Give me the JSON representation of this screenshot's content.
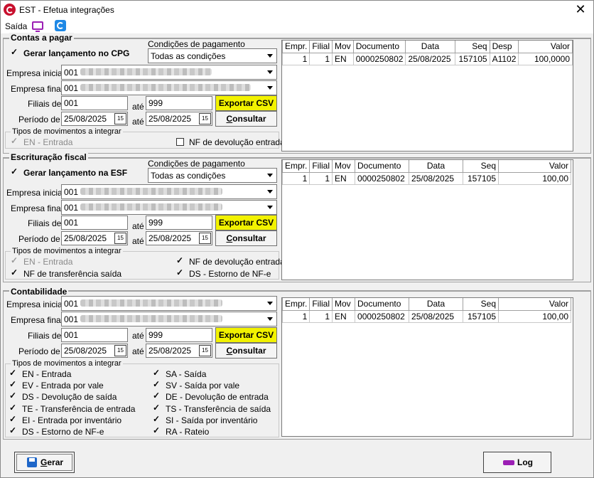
{
  "window": {
    "title": "EST - Efetua integrações",
    "close": "✕"
  },
  "menu": {
    "saida": "Saída"
  },
  "cpg": {
    "title": "Contas a pagar",
    "gerar_label": "Gerar lançamento no CPG",
    "cond_label": "Condições de pagamento",
    "cond_value": "Todas as condições",
    "empresa_inicial_label": "Empresa inicial",
    "empresa_inicial_value": "001",
    "empresa_final_label": "Empresa final",
    "empresa_final_value": "001",
    "filiais_label": "Filiais de",
    "filial_de": "001",
    "ate": "até",
    "filial_ate": "999",
    "exportar": "Exportar CSV",
    "periodo_label": "Período de",
    "periodo_de": "25/08/2025",
    "periodo_ate": "25/08/2025",
    "consultar_c": "C",
    "consultar_rest": "onsultar",
    "tipos_title": "Tipos de movimentos a integrar",
    "tipos": {
      "en": "EN - Entrada",
      "nf_dev": "NF de devolução entrada"
    },
    "grid": {
      "headers": [
        "Empr.",
        "Filial",
        "Mov",
        "Documento",
        "Data",
        "Seq",
        "Desp",
        "Valor"
      ],
      "row": [
        "1",
        "1",
        "EN",
        "0000250802",
        "25/08/2025",
        "157105",
        "A1102",
        "100,0000"
      ]
    }
  },
  "esf": {
    "title": "Escrituração fiscal",
    "gerar_label": "Gerar lançamento na ESF",
    "cond_label": "Condições de pagamento",
    "cond_value": "Todas as condições",
    "empresa_inicial_label": "Empresa inicial",
    "empresa_inicial_value": "001",
    "empresa_final_label": "Empresa final",
    "empresa_final_value": "001",
    "filiais_label": "Filiais de",
    "filial_de": "001",
    "ate": "até",
    "filial_ate": "999",
    "exportar": "Exportar CSV",
    "periodo_label": "Período de",
    "periodo_de": "25/08/2025",
    "periodo_ate": "25/08/2025",
    "consultar_c": "C",
    "consultar_rest": "onsultar",
    "tipos_title": "Tipos de movimentos a integrar",
    "tipos": {
      "en": "EN - Entrada",
      "nf_dev": "NF de devolução entrada",
      "nf_transf": "NF de transferência saída",
      "ds": "DS - Estorno de NF-e"
    },
    "grid": {
      "headers": [
        "Empr.",
        "Filial",
        "Mov",
        "Documento",
        "Data",
        "Seq",
        "Valor"
      ],
      "row": [
        "1",
        "1",
        "EN",
        "0000250802",
        "25/08/2025",
        "157105",
        "100,00"
      ]
    }
  },
  "ctb": {
    "title": "Contabilidade",
    "empresa_inicial_label": "Empresa inicial",
    "empresa_inicial_value": "001",
    "empresa_final_label": "Empresa final",
    "empresa_final_value": "001",
    "filiais_label": "Filiais de",
    "filial_de": "001",
    "ate": "até",
    "filial_ate": "999",
    "exportar": "Exportar CSV",
    "periodo_label": "Período de",
    "periodo_de": "25/08/2025",
    "periodo_ate": "25/08/2025",
    "consultar_c": "C",
    "consultar_rest": "onsultar",
    "tipos_title": "Tipos de movimentos a integrar",
    "tipos_left": [
      "EN - Entrada",
      "EV - Entrada por vale",
      "DS - Devolução de saída",
      "TE - Transferência de entrada",
      "EI - Entrada por inventário",
      "DS - Estorno de NF-e"
    ],
    "tipos_right": [
      "SA - Saída",
      "SV - Saída por vale",
      "DE - Devolução de entrada",
      "TS - Transferência de saída",
      "SI - Saída por inventário",
      "RA - Rateio"
    ],
    "grid": {
      "headers": [
        "Empr.",
        "Filial",
        "Mov",
        "Documento",
        "Data",
        "Seq",
        "Valor"
      ],
      "row": [
        "1",
        "1",
        "EN",
        "0000250802",
        "25/08/2025",
        "157105",
        "100,00"
      ]
    }
  },
  "footer": {
    "gerar_g": "G",
    "gerar_rest": "erar",
    "log": "Log"
  },
  "icons": {
    "app": "app-logo-icon",
    "monitor": "monitor-icon",
    "brand": "brand-g-icon",
    "calendar": "calendar-icon",
    "save": "save-icon",
    "print": "printer-icon"
  },
  "calendar_glyph": "15"
}
